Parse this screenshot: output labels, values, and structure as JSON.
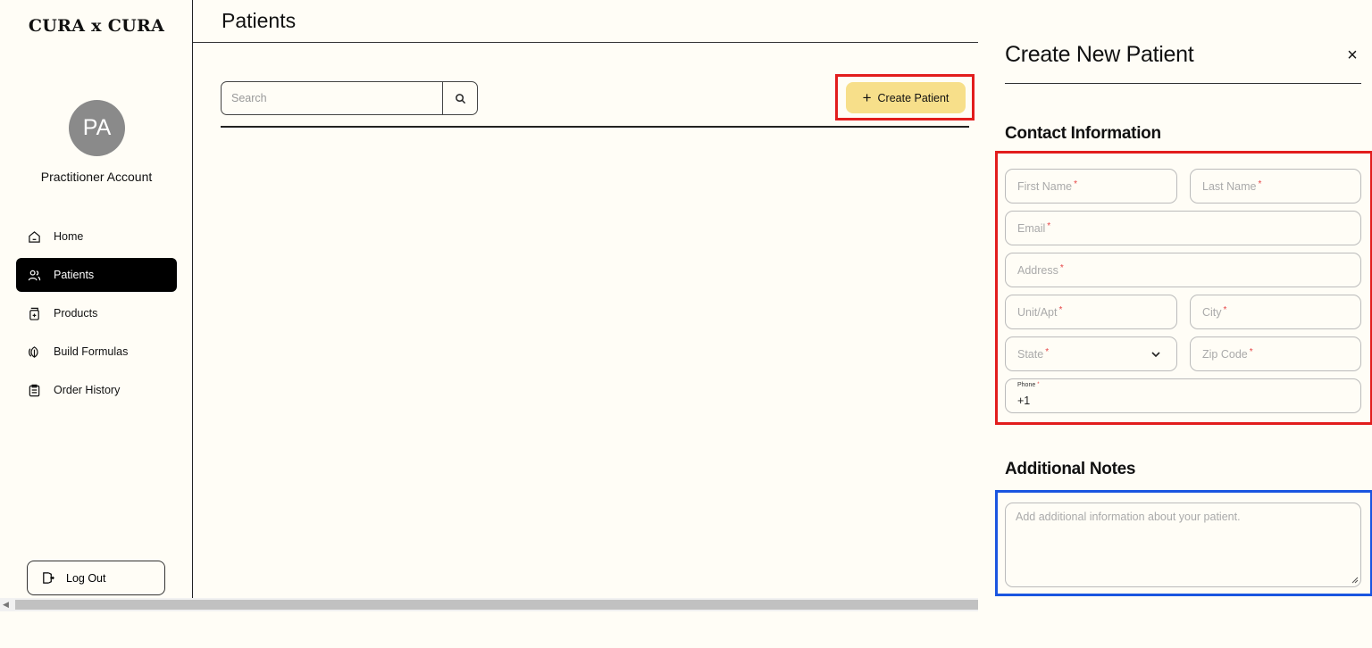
{
  "sidebar": {
    "brand": "CURA x CURA",
    "avatar_initials": "PA",
    "account_name": "Practitioner Account",
    "items": [
      {
        "label": "Home",
        "icon": "home-icon",
        "active": false
      },
      {
        "label": "Patients",
        "icon": "users-icon",
        "active": true
      },
      {
        "label": "Products",
        "icon": "product-jar-icon",
        "active": false
      },
      {
        "label": "Build Formulas",
        "icon": "leaf-icon",
        "active": false
      },
      {
        "label": "Order History",
        "icon": "clipboard-icon",
        "active": false
      }
    ],
    "logout_label": "Log Out"
  },
  "main": {
    "title": "Patients",
    "search_placeholder": "Search",
    "create_label": "Create Patient"
  },
  "panel": {
    "title": "Create New Patient",
    "close_glyph": "×",
    "contact_title": "Contact Information",
    "fields": {
      "first_name": "First Name",
      "last_name": "Last Name",
      "email": "Email",
      "address": "Address",
      "unit": "Unit/Apt",
      "city": "City",
      "state": "State",
      "zip": "Zip Code",
      "phone_label": "Phone",
      "phone_value": "+1"
    },
    "required_mark": "*",
    "notes_title": "Additional Notes",
    "notes_placeholder": "Add additional information about your patient."
  },
  "colors": {
    "background": "#fffdf6",
    "accent_yellow": "#f7df8a",
    "highlight_red": "#e21d1d",
    "highlight_blue": "#1a55e0",
    "active_nav": "#000000"
  }
}
